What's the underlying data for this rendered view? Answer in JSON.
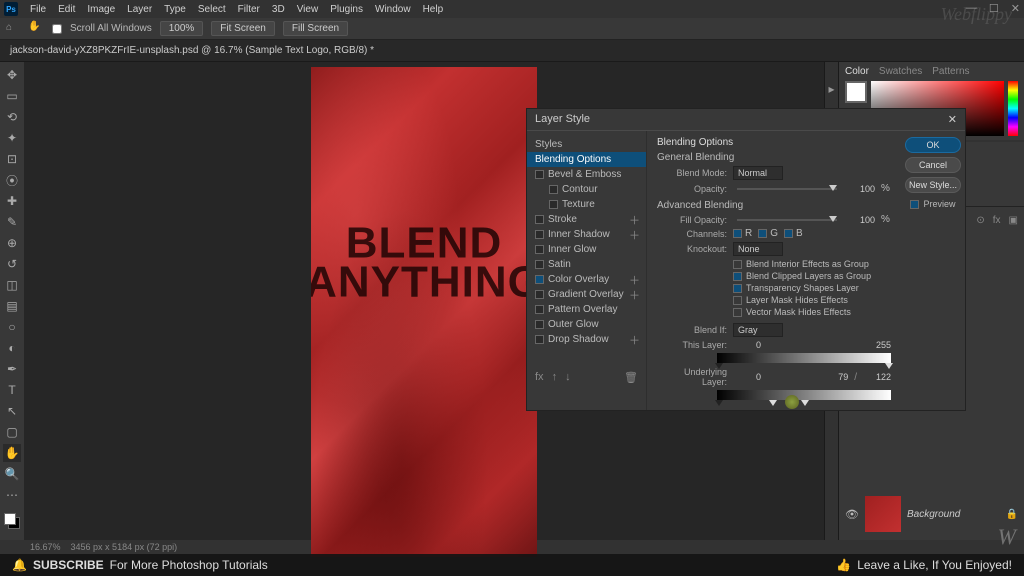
{
  "menu": {
    "items": [
      "File",
      "Edit",
      "Image",
      "Layer",
      "Type",
      "Select",
      "Filter",
      "3D",
      "View",
      "Plugins",
      "Window",
      "Help"
    ]
  },
  "options": {
    "scroll_all": "Scroll All Windows",
    "zoom": "100%",
    "fit": "Fit Screen",
    "fill": "Fill Screen"
  },
  "doc_tab": "jackson-david-yXZ8PKZFrIE-unsplash.psd @ 16.7% (Sample Text Logo, RGB/8) *",
  "canvas": {
    "line1": "BLEND",
    "line2": "ANYTHING"
  },
  "panels": {
    "color_tabs": [
      "Color",
      "Swatches",
      "Patterns"
    ]
  },
  "layer": {
    "name": "Background"
  },
  "dialog": {
    "title": "Layer Style",
    "styles_hdr": "Styles",
    "styles": {
      "blending_options": "Blending Options",
      "bevel": "Bevel & Emboss",
      "contour": "Contour",
      "texture": "Texture",
      "stroke": "Stroke",
      "inner_shadow": "Inner Shadow",
      "inner_glow": "Inner Glow",
      "satin": "Satin",
      "color_overlay": "Color Overlay",
      "gradient_overlay": "Gradient Overlay",
      "pattern_overlay": "Pattern Overlay",
      "outer_glow": "Outer Glow",
      "drop_shadow": "Drop Shadow"
    },
    "opts": {
      "section": "Blending Options",
      "general": "General Blending",
      "blend_mode_lbl": "Blend Mode:",
      "blend_mode": "Normal",
      "opacity_lbl": "Opacity:",
      "opacity": "100",
      "pct": "%",
      "advanced": "Advanced Blending",
      "fill_lbl": "Fill Opacity:",
      "fill": "100",
      "channels_lbl": "Channels:",
      "ch_r": "R",
      "ch_g": "G",
      "ch_b": "B",
      "knockout_lbl": "Knockout:",
      "knockout": "None",
      "chk_interior": "Blend Interior Effects as Group",
      "chk_clipped": "Blend Clipped Layers as Group",
      "chk_transp": "Transparency Shapes Layer",
      "chk_lmask": "Layer Mask Hides Effects",
      "chk_vmask": "Vector Mask Hides Effects",
      "blendif_lbl": "Blend If:",
      "blendif": "Gray",
      "this_layer_lbl": "This Layer:",
      "this_lo": "0",
      "this_hi": "255",
      "under_lbl": "Underlying Layer:",
      "under_lo": "0",
      "under_mid": "79",
      "under_hi": "122"
    },
    "btns": {
      "ok": "OK",
      "cancel": "Cancel",
      "newstyle": "New Style...",
      "preview": "Preview"
    }
  },
  "status": {
    "zoom": "16.67%",
    "dims": "3456 px x 5184 px (72 ppi)"
  },
  "footer": {
    "subscribe": "SUBSCRIBE",
    "subscribe_tail": " For More Photoshop Tutorials",
    "like": "Leave a Like, If You Enjoyed!"
  },
  "watermark": "Webflippy",
  "watermark_w": "W"
}
